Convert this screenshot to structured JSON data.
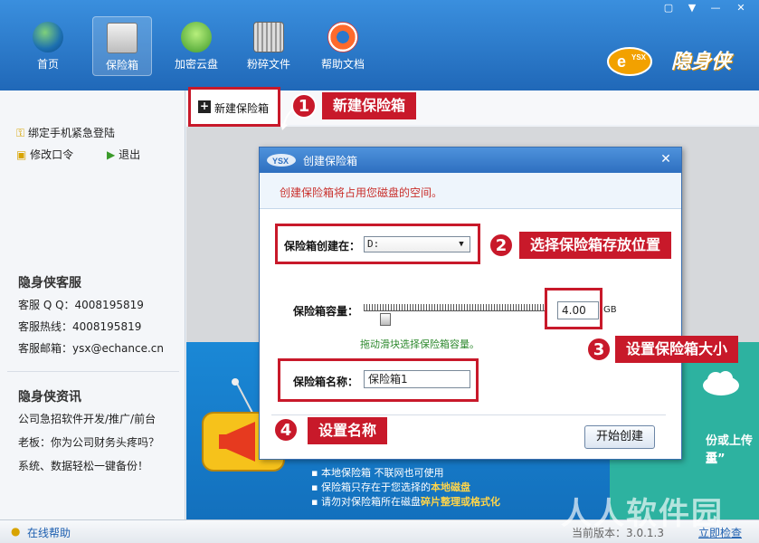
{
  "nav": {
    "items": [
      {
        "label": "首页",
        "icon": "globe-icon"
      },
      {
        "label": "保险箱",
        "icon": "safe-icon"
      },
      {
        "label": "加密云盘",
        "icon": "cloud-icon"
      },
      {
        "label": "粉碎文件",
        "icon": "shredder-icon"
      },
      {
        "label": "帮助文档",
        "icon": "lifebuoy-icon"
      }
    ],
    "active": "保险箱"
  },
  "window_controls": [
    "shirt-icon",
    "menu-icon",
    "minimize-icon",
    "close-icon"
  ],
  "logo": {
    "badge": "e YSX",
    "text": "隐身侠"
  },
  "left_panel": {
    "bind_phone": "绑定手机紧急登陆",
    "change_password": "修改口令",
    "logout": "退出",
    "service_title": "隐身侠客服",
    "service_qq": "客服 Q Q：4008195819",
    "service_hotline": "客服热线：4008195819",
    "service_email": "客服邮箱：ysx@echance.cn",
    "news_title": "隐身侠资讯",
    "news_items": [
      "公司急招软件开发/推广/前台",
      "老板：你为公司财务头疼吗？",
      "系统、数据轻松一键备份！"
    ]
  },
  "toolbar": {
    "new_vault": "新建保险箱"
  },
  "banner": {
    "items": [
      {
        "prefix": "本地保险箱",
        "rest": "不联网也可使用"
      },
      {
        "prefix": "保险箱只存在于您选择的",
        "bold": "本地磁盘"
      },
      {
        "prefix": "请勿对保险箱所在磁盘",
        "bold": "碎片整理或格式化"
      }
    ],
    "right_text": "份或上传至",
    "right_text2": "盘”"
  },
  "dialog": {
    "title": "创建保险箱",
    "subtitle": "创建保险箱将占用您磁盘的空间。",
    "location_label": "保险箱创建在：",
    "location_value": "D:",
    "capacity_label": "保险箱容量：",
    "capacity_value": "4.00",
    "capacity_unit": "GB",
    "capacity_fraction": 0.12,
    "hint": "拖动滑块选择保险箱容量。",
    "name_label": "保险箱名称：",
    "name_value": "保险箱1",
    "start_button": "开始创建"
  },
  "callouts": [
    {
      "num": "1",
      "text": "新建保险箱"
    },
    {
      "num": "2",
      "text": "选择保险箱存放位置"
    },
    {
      "num": "3",
      "text": "设置保险箱大小"
    },
    {
      "num": "4",
      "text": "设置名称"
    }
  ],
  "status": {
    "help": "在线帮助",
    "version": "当前版本：3.0.1.3",
    "check": "立即检查",
    "watermark": "人人软件园"
  },
  "colors": {
    "brand_blue": "#2a78cc",
    "callout_red": "#c8192a",
    "hint_green": "#2f8a2f"
  }
}
